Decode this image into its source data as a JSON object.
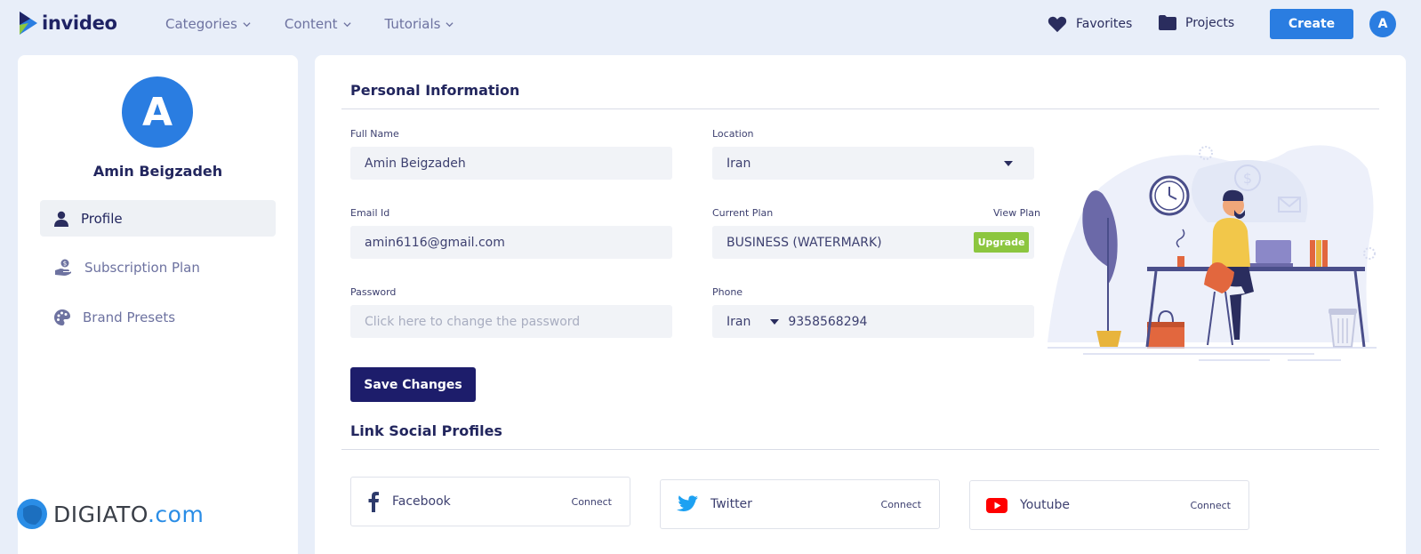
{
  "brand": {
    "name": "invideo"
  },
  "nav": {
    "items": [
      {
        "label": "Categories"
      },
      {
        "label": "Content"
      },
      {
        "label": "Tutorials"
      }
    ],
    "favorites_label": "Favorites",
    "projects_label": "Projects",
    "create_label": "Create",
    "avatar_initial": "A"
  },
  "sidebar": {
    "avatar_initial": "A",
    "user_name": "Amin Beigzadeh",
    "items": [
      {
        "label": "Profile",
        "icon": "user-icon",
        "active": true
      },
      {
        "label": "Subscription Plan",
        "icon": "subscription-icon",
        "active": false
      },
      {
        "label": "Brand Presets",
        "icon": "palette-icon",
        "active": false
      }
    ]
  },
  "personal_info": {
    "title": "Personal Information",
    "full_name": {
      "label": "Full Name",
      "value": "Amin Beigzadeh"
    },
    "location": {
      "label": "Location",
      "value": "Iran"
    },
    "email": {
      "label": "Email Id",
      "value": "amin6116@gmail.com"
    },
    "current_plan": {
      "label": "Current Plan",
      "value": "BUSINESS (WATERMARK)",
      "view_plan": "View Plan",
      "upgrade": "Upgrade"
    },
    "password": {
      "label": "Password",
      "placeholder": "Click here to change the password"
    },
    "phone": {
      "label": "Phone",
      "country": "Iran",
      "number": "9358568294"
    },
    "save_label": "Save Changes"
  },
  "social": {
    "title": "Link Social Profiles",
    "items": [
      {
        "name": "Facebook",
        "action": "Connect",
        "icon": "facebook-icon",
        "color": "#2d3a6b"
      },
      {
        "name": "Twitter",
        "action": "Connect",
        "icon": "twitter-icon",
        "color": "#1da1f2"
      },
      {
        "name": "Youtube",
        "action": "Connect",
        "icon": "youtube-icon",
        "color": "#ff0000"
      }
    ]
  },
  "watermark": {
    "text_a": "DIGIATO",
    "text_b": ".com"
  },
  "colors": {
    "accent": "#2a7de1",
    "primary_dark": "#1d1d6b",
    "upgrade": "#8cc63f",
    "page_bg": "#e8eef9"
  }
}
